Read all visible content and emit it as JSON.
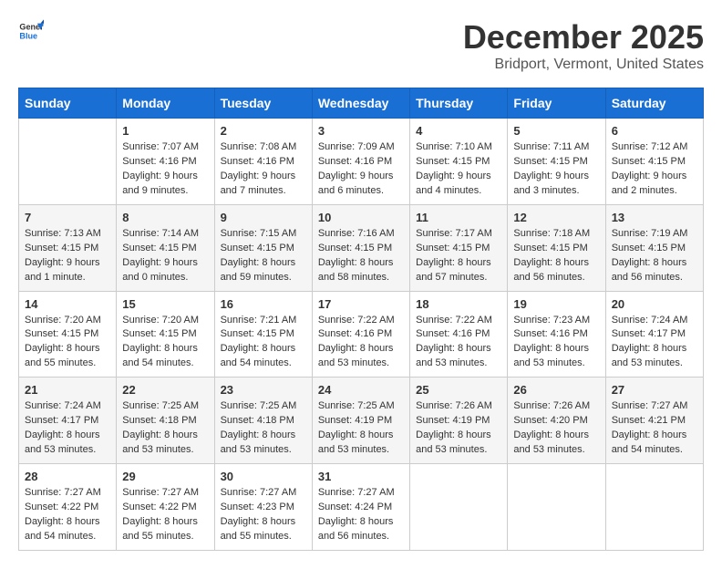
{
  "header": {
    "logo_general": "General",
    "logo_blue": "Blue",
    "month": "December 2025",
    "location": "Bridport, Vermont, United States"
  },
  "weekdays": [
    "Sunday",
    "Monday",
    "Tuesday",
    "Wednesday",
    "Thursday",
    "Friday",
    "Saturday"
  ],
  "weeks": [
    [
      {
        "day": "",
        "info": ""
      },
      {
        "day": "1",
        "info": "Sunrise: 7:07 AM\nSunset: 4:16 PM\nDaylight: 9 hours\nand 9 minutes."
      },
      {
        "day": "2",
        "info": "Sunrise: 7:08 AM\nSunset: 4:16 PM\nDaylight: 9 hours\nand 7 minutes."
      },
      {
        "day": "3",
        "info": "Sunrise: 7:09 AM\nSunset: 4:16 PM\nDaylight: 9 hours\nand 6 minutes."
      },
      {
        "day": "4",
        "info": "Sunrise: 7:10 AM\nSunset: 4:15 PM\nDaylight: 9 hours\nand 4 minutes."
      },
      {
        "day": "5",
        "info": "Sunrise: 7:11 AM\nSunset: 4:15 PM\nDaylight: 9 hours\nand 3 minutes."
      },
      {
        "day": "6",
        "info": "Sunrise: 7:12 AM\nSunset: 4:15 PM\nDaylight: 9 hours\nand 2 minutes."
      }
    ],
    [
      {
        "day": "7",
        "info": "Sunrise: 7:13 AM\nSunset: 4:15 PM\nDaylight: 9 hours\nand 1 minute."
      },
      {
        "day": "8",
        "info": "Sunrise: 7:14 AM\nSunset: 4:15 PM\nDaylight: 9 hours\nand 0 minutes."
      },
      {
        "day": "9",
        "info": "Sunrise: 7:15 AM\nSunset: 4:15 PM\nDaylight: 8 hours\nand 59 minutes."
      },
      {
        "day": "10",
        "info": "Sunrise: 7:16 AM\nSunset: 4:15 PM\nDaylight: 8 hours\nand 58 minutes."
      },
      {
        "day": "11",
        "info": "Sunrise: 7:17 AM\nSunset: 4:15 PM\nDaylight: 8 hours\nand 57 minutes."
      },
      {
        "day": "12",
        "info": "Sunrise: 7:18 AM\nSunset: 4:15 PM\nDaylight: 8 hours\nand 56 minutes."
      },
      {
        "day": "13",
        "info": "Sunrise: 7:19 AM\nSunset: 4:15 PM\nDaylight: 8 hours\nand 56 minutes."
      }
    ],
    [
      {
        "day": "14",
        "info": "Sunrise: 7:20 AM\nSunset: 4:15 PM\nDaylight: 8 hours\nand 55 minutes."
      },
      {
        "day": "15",
        "info": "Sunrise: 7:20 AM\nSunset: 4:15 PM\nDaylight: 8 hours\nand 54 minutes."
      },
      {
        "day": "16",
        "info": "Sunrise: 7:21 AM\nSunset: 4:15 PM\nDaylight: 8 hours\nand 54 minutes."
      },
      {
        "day": "17",
        "info": "Sunrise: 7:22 AM\nSunset: 4:16 PM\nDaylight: 8 hours\nand 53 minutes."
      },
      {
        "day": "18",
        "info": "Sunrise: 7:22 AM\nSunset: 4:16 PM\nDaylight: 8 hours\nand 53 minutes."
      },
      {
        "day": "19",
        "info": "Sunrise: 7:23 AM\nSunset: 4:16 PM\nDaylight: 8 hours\nand 53 minutes."
      },
      {
        "day": "20",
        "info": "Sunrise: 7:24 AM\nSunset: 4:17 PM\nDaylight: 8 hours\nand 53 minutes."
      }
    ],
    [
      {
        "day": "21",
        "info": "Sunrise: 7:24 AM\nSunset: 4:17 PM\nDaylight: 8 hours\nand 53 minutes."
      },
      {
        "day": "22",
        "info": "Sunrise: 7:25 AM\nSunset: 4:18 PM\nDaylight: 8 hours\nand 53 minutes."
      },
      {
        "day": "23",
        "info": "Sunrise: 7:25 AM\nSunset: 4:18 PM\nDaylight: 8 hours\nand 53 minutes."
      },
      {
        "day": "24",
        "info": "Sunrise: 7:25 AM\nSunset: 4:19 PM\nDaylight: 8 hours\nand 53 minutes."
      },
      {
        "day": "25",
        "info": "Sunrise: 7:26 AM\nSunset: 4:19 PM\nDaylight: 8 hours\nand 53 minutes."
      },
      {
        "day": "26",
        "info": "Sunrise: 7:26 AM\nSunset: 4:20 PM\nDaylight: 8 hours\nand 53 minutes."
      },
      {
        "day": "27",
        "info": "Sunrise: 7:27 AM\nSunset: 4:21 PM\nDaylight: 8 hours\nand 54 minutes."
      }
    ],
    [
      {
        "day": "28",
        "info": "Sunrise: 7:27 AM\nSunset: 4:22 PM\nDaylight: 8 hours\nand 54 minutes."
      },
      {
        "day": "29",
        "info": "Sunrise: 7:27 AM\nSunset: 4:22 PM\nDaylight: 8 hours\nand 55 minutes."
      },
      {
        "day": "30",
        "info": "Sunrise: 7:27 AM\nSunset: 4:23 PM\nDaylight: 8 hours\nand 55 minutes."
      },
      {
        "day": "31",
        "info": "Sunrise: 7:27 AM\nSunset: 4:24 PM\nDaylight: 8 hours\nand 56 minutes."
      },
      {
        "day": "",
        "info": ""
      },
      {
        "day": "",
        "info": ""
      },
      {
        "day": "",
        "info": ""
      }
    ]
  ]
}
